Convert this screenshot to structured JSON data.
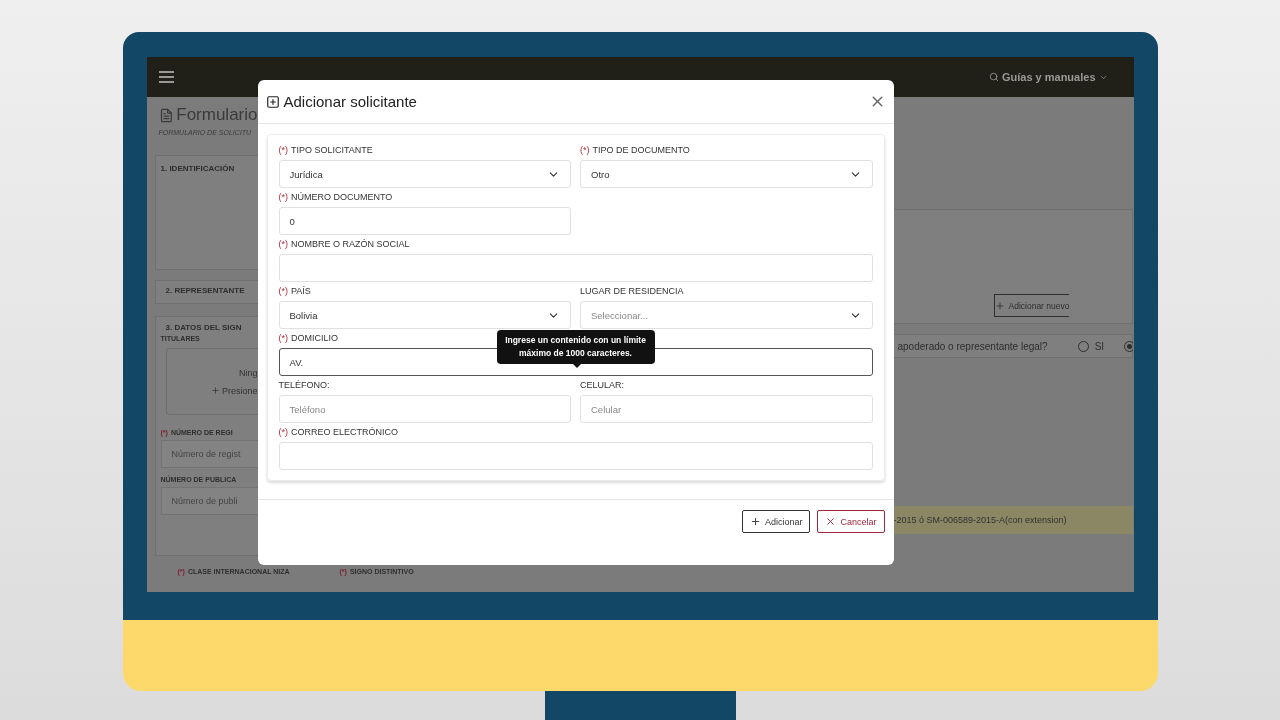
{
  "navbar": {
    "link": "Guías y manuales"
  },
  "background": {
    "title": "Formulario",
    "subtitle": "FORMULARIO DE SOLICITU",
    "section1": {
      "title": "1. IDENTIFICACIÓN",
      "add_button": "Adicionar nuevo"
    },
    "section2": {
      "title": "2. REPRESENTANTE",
      "question": "apoderado o representante legal?",
      "options": [
        {
          "label": "SI",
          "selected": false
        },
        {
          "selected": true
        }
      ]
    },
    "section3": {
      "title": "3. DATOS DEL SIGN",
      "titulares_label": "TITULARES",
      "empty_text": "Ning",
      "add_hint": "Presione",
      "fields": [
        {
          "mark": "(*)",
          "label": "NÚMERO DE REGI",
          "placeholder": "Número de regist"
        },
        {
          "label": "NÚMERO DE PUBLICA",
          "placeholder": "Número de publi"
        }
      ],
      "notice": "-2015 ó SM-006589-2015-A(con extension)",
      "bottom_labels": [
        {
          "mark": "(*)",
          "label": "CLASE INTERNACIONAL NIZA"
        },
        {
          "mark": "(*)",
          "label": "SIGNO DISTINTIVO"
        }
      ]
    }
  },
  "modal": {
    "title": "Adicionar solicitante",
    "rows": [
      [
        {
          "kind": "select",
          "mark": "(*)",
          "label": "TIPO SOLICITANTE",
          "value": "Jurídica",
          "focused": false
        },
        {
          "kind": "select",
          "mark": "(*)",
          "label": "TIPO DE DOCUMENTO",
          "value": "Otro",
          "focused": false
        }
      ],
      [
        {
          "kind": "input",
          "mark": "(*)",
          "label": "NÚMERO DOCUMENTO",
          "value": "0",
          "focused": false
        },
        null
      ],
      [
        {
          "kind": "input",
          "mark": "(*)",
          "label": "NOMBRE O RAZÓN SOCIAL",
          "focused": false
        }
      ],
      [
        {
          "kind": "select",
          "mark": "(*)",
          "label": "PAÍS",
          "value": "Bolivia",
          "focused": false
        },
        {
          "kind": "select",
          "label": "LUGAR DE RESIDENCIA",
          "placeholder": "Seleccionar...",
          "focused": false
        }
      ],
      [
        {
          "kind": "input",
          "mark": "(*)",
          "label": "DOMICILIO",
          "value": "AV.",
          "focused": true
        }
      ],
      [
        {
          "kind": "input",
          "label": "TELÉFONO:",
          "placeholder": "Teléfono",
          "focused": false
        },
        {
          "kind": "input",
          "label": "CELULAR:",
          "placeholder": "Celular",
          "focused": false
        }
      ],
      [
        {
          "kind": "input",
          "mark": "(*)",
          "label": "CORREO ELECTRÓNICO",
          "focused": false
        }
      ]
    ],
    "tooltip": {
      "lines": [
        "Ingrese un contenido con un límite",
        "máximo de 1000 caracteres."
      ]
    },
    "buttons": [
      {
        "kind": "add",
        "label": "Adicionar"
      },
      {
        "kind": "cancel",
        "label": "Cancelar"
      }
    ]
  }
}
